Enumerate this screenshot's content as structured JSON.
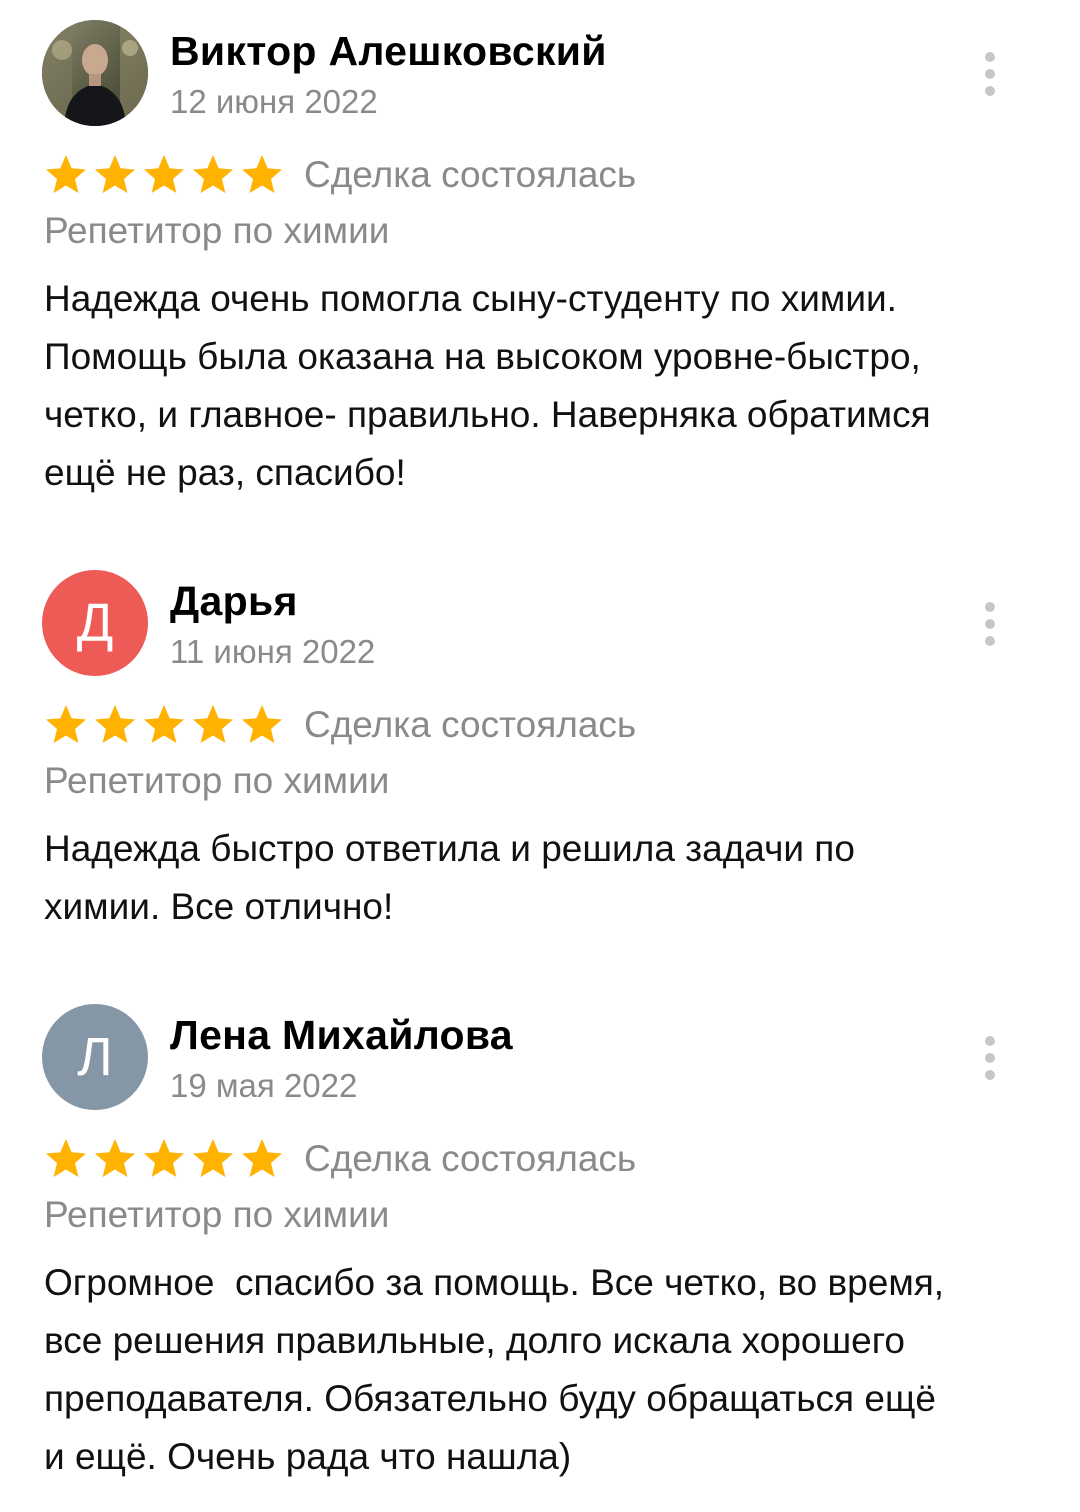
{
  "reviews": [
    {
      "author": "Виктор Алешковский",
      "date": "12 июня 2022",
      "avatar": {
        "type": "photo",
        "letter": ""
      },
      "rating": 5,
      "deal_status": "Сделка состоялась",
      "category": "Репетитор по химии",
      "text_lines": [
        "Надежда очень помогла сыну-студенту по химии.",
        "Помощь была оказана на высоком уровне-быстро,",
        "четко, и главное- правильно. Наверняка обратимся",
        "ещё не раз, спасибо!"
      ]
    },
    {
      "author": "Дарья",
      "date": "11 июня 2022",
      "avatar": {
        "type": "letter",
        "letter": "Д",
        "color": "#ee5a55"
      },
      "rating": 5,
      "deal_status": "Сделка состоялась",
      "category": "Репетитор по химии",
      "text_lines": [
        "Надежда быстро ответила и решила задачи по",
        "химии. Все отлично!"
      ]
    },
    {
      "author": "Лена Михайлова",
      "date": "19 мая 2022",
      "avatar": {
        "type": "letter",
        "letter": "Л",
        "color": "#8597a6"
      },
      "rating": 5,
      "deal_status": "Сделка состоялась",
      "category": "Репетитор по химии",
      "text_lines": [
        "Огромное  спасибо за помощь. Все четко, во время,",
        "все решения правильные, долго искала хорошего",
        "преподавателя. Обязательно буду обращаться ещё",
        "и ещё. Очень рада что нашла)"
      ]
    }
  ],
  "colors": {
    "star": "#ffb200",
    "secondary_text": "#8a8a8a",
    "menu_dots": "#c6c6c6"
  },
  "icons": {
    "star": "star-icon",
    "menu": "more-vertical-icon"
  }
}
